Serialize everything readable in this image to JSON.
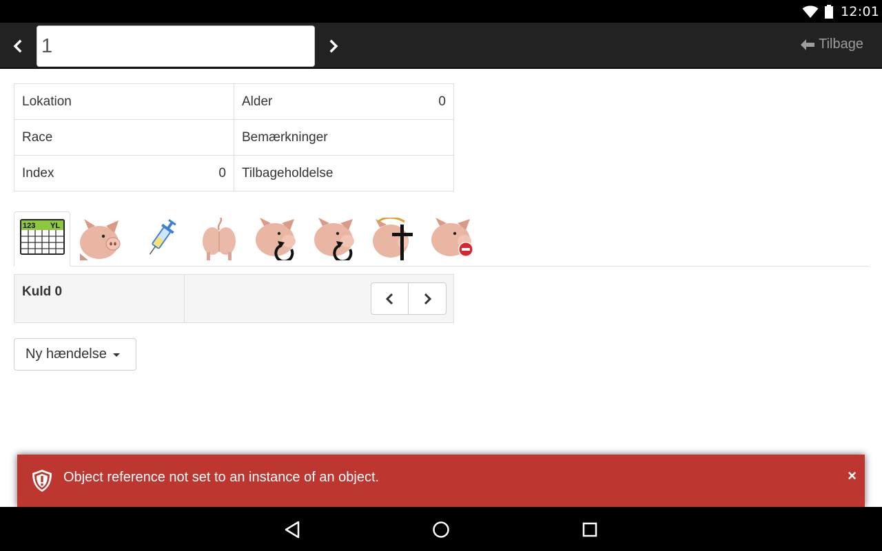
{
  "status_bar": {
    "time": "12:01",
    "icons": [
      "wifi-icon",
      "battery-icon"
    ]
  },
  "toolbar": {
    "id_value": "1",
    "back_label": "Tilbage"
  },
  "info": {
    "lokation_label": "Lokation",
    "lokation_value": "",
    "alder_label": "Alder",
    "alder_value": "0",
    "race_label": "Race",
    "race_value": "",
    "bemaerkninger_label": "Bemærkninger",
    "bemaerkninger_value": "",
    "index_label": "Index",
    "index_value": "0",
    "tilbageholdelse_label": "Tilbageholdelse",
    "tilbageholdelse_value": ""
  },
  "tabs": {
    "calendar_text_left": "123",
    "calendar_text_right": "YL",
    "icons": [
      "calendar-icon",
      "pig-icon",
      "syringe-icon",
      "pig-rear-icon",
      "pig-rotate-icon",
      "pig-rotate-icon-2",
      "pig-death-icon",
      "pig-remove-icon"
    ]
  },
  "kuld": {
    "label": "Kuld 0"
  },
  "dropdown": {
    "label": "Ny hændelse"
  },
  "toast": {
    "message": "Object reference not set to an instance of an object.",
    "close": "×"
  },
  "colors": {
    "toolbar": "#222222",
    "error": "#bd362f",
    "panel": "#f5f5f5",
    "border": "#dddddd"
  }
}
